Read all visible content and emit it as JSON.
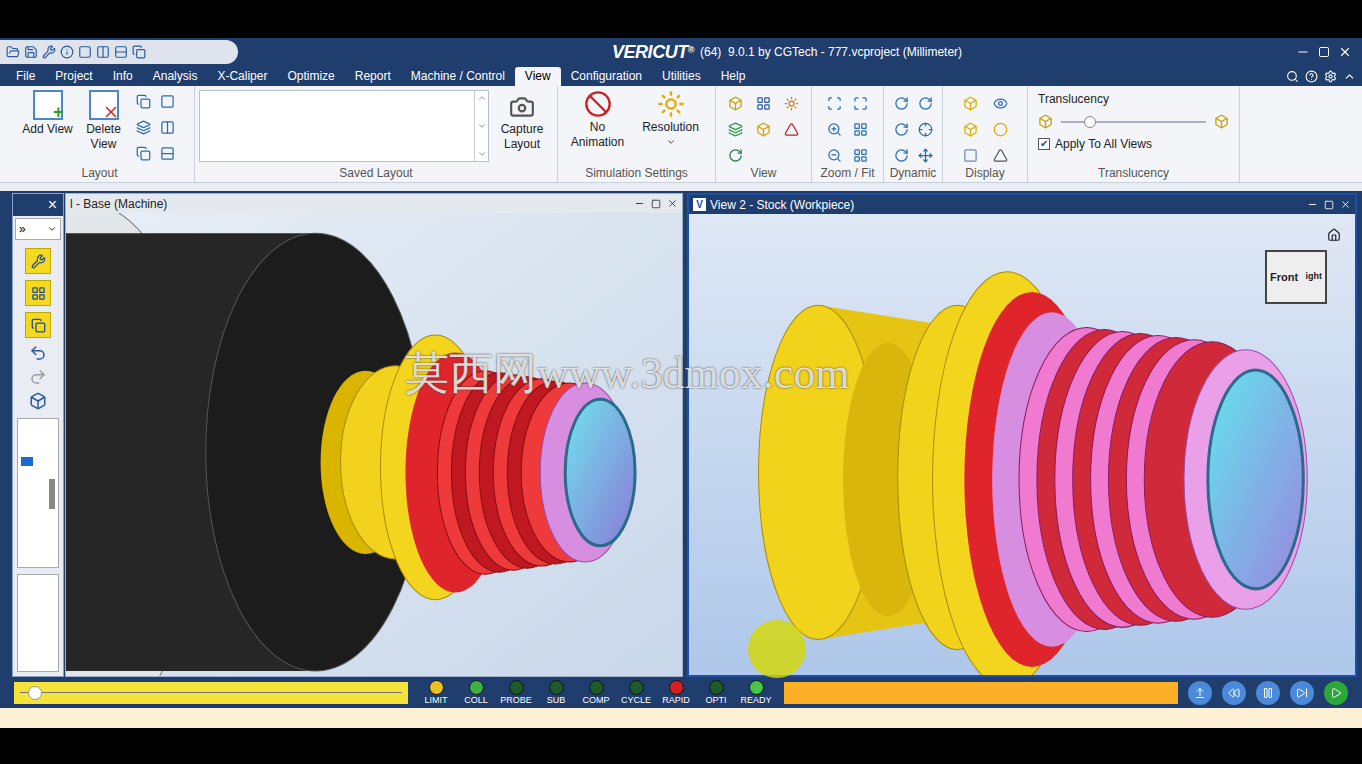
{
  "titlebar": {
    "logo": "VERICUT",
    "registered": "®",
    "title": "(64)  9.0.1 by CGTech - 777.vcproject (Millimeter)"
  },
  "menu": [
    {
      "label": "File",
      "selected": false
    },
    {
      "label": "Project",
      "selected": false
    },
    {
      "label": "Info",
      "selected": false
    },
    {
      "label": "Analysis",
      "selected": false
    },
    {
      "label": "X-Caliper",
      "selected": false
    },
    {
      "label": "Optimize",
      "selected": false
    },
    {
      "label": "Report",
      "selected": false
    },
    {
      "label": "Machine / Control",
      "selected": false
    },
    {
      "label": "View",
      "selected": true
    },
    {
      "label": "Configuration",
      "selected": false
    },
    {
      "label": "Utilities",
      "selected": false
    },
    {
      "label": "Help",
      "selected": false
    }
  ],
  "ribbon": {
    "layout": {
      "label": "Layout",
      "buttons": [
        "Add View",
        "Delete View"
      ]
    },
    "saved_layout": {
      "label": "Saved Layout",
      "button": "Capture Layout"
    },
    "simulation": {
      "label": "Simulation Settings",
      "buttons": [
        "No Animation",
        "Resolution"
      ]
    },
    "view": {
      "label": "View"
    },
    "zoom": {
      "label": "Zoom / Fit"
    },
    "dynamic": {
      "label": "Dynamic"
    },
    "display": {
      "label": "Display"
    },
    "translucency": {
      "label": "Translucency",
      "header": "Translucency",
      "level": 0.2,
      "apply_all": {
        "label": "Apply To All Views",
        "checked": true
      }
    }
  },
  "tool_panel": {
    "close": "×",
    "selector": "»"
  },
  "views": [
    {
      "title": "l - Base (Machine)",
      "active": false
    },
    {
      "title": "View 2 - Stock (Workpiece)",
      "active": true
    }
  ],
  "view_cube": {
    "front": "Front",
    "right": "ight"
  },
  "watermark": "莫西网www.3dmox.com",
  "animation_slider": {
    "level": 0.03
  },
  "lights": [
    {
      "label": "LIMIT",
      "color": "#e8c020"
    },
    {
      "label": "COLL",
      "color": "#3cb043"
    },
    {
      "label": "PROBE",
      "color": "#1e5a2a"
    },
    {
      "label": "SUB",
      "color": "#1e5a2a"
    },
    {
      "label": "COMP",
      "color": "#1e5a2a"
    },
    {
      "label": "CYCLE",
      "color": "#1e5a2a"
    },
    {
      "label": "RAPID",
      "color": "#d42020"
    },
    {
      "label": "OPTI",
      "color": "#1e5a2a"
    },
    {
      "label": "READY",
      "color": "#48c648"
    }
  ],
  "progress": {
    "level": 1
  }
}
